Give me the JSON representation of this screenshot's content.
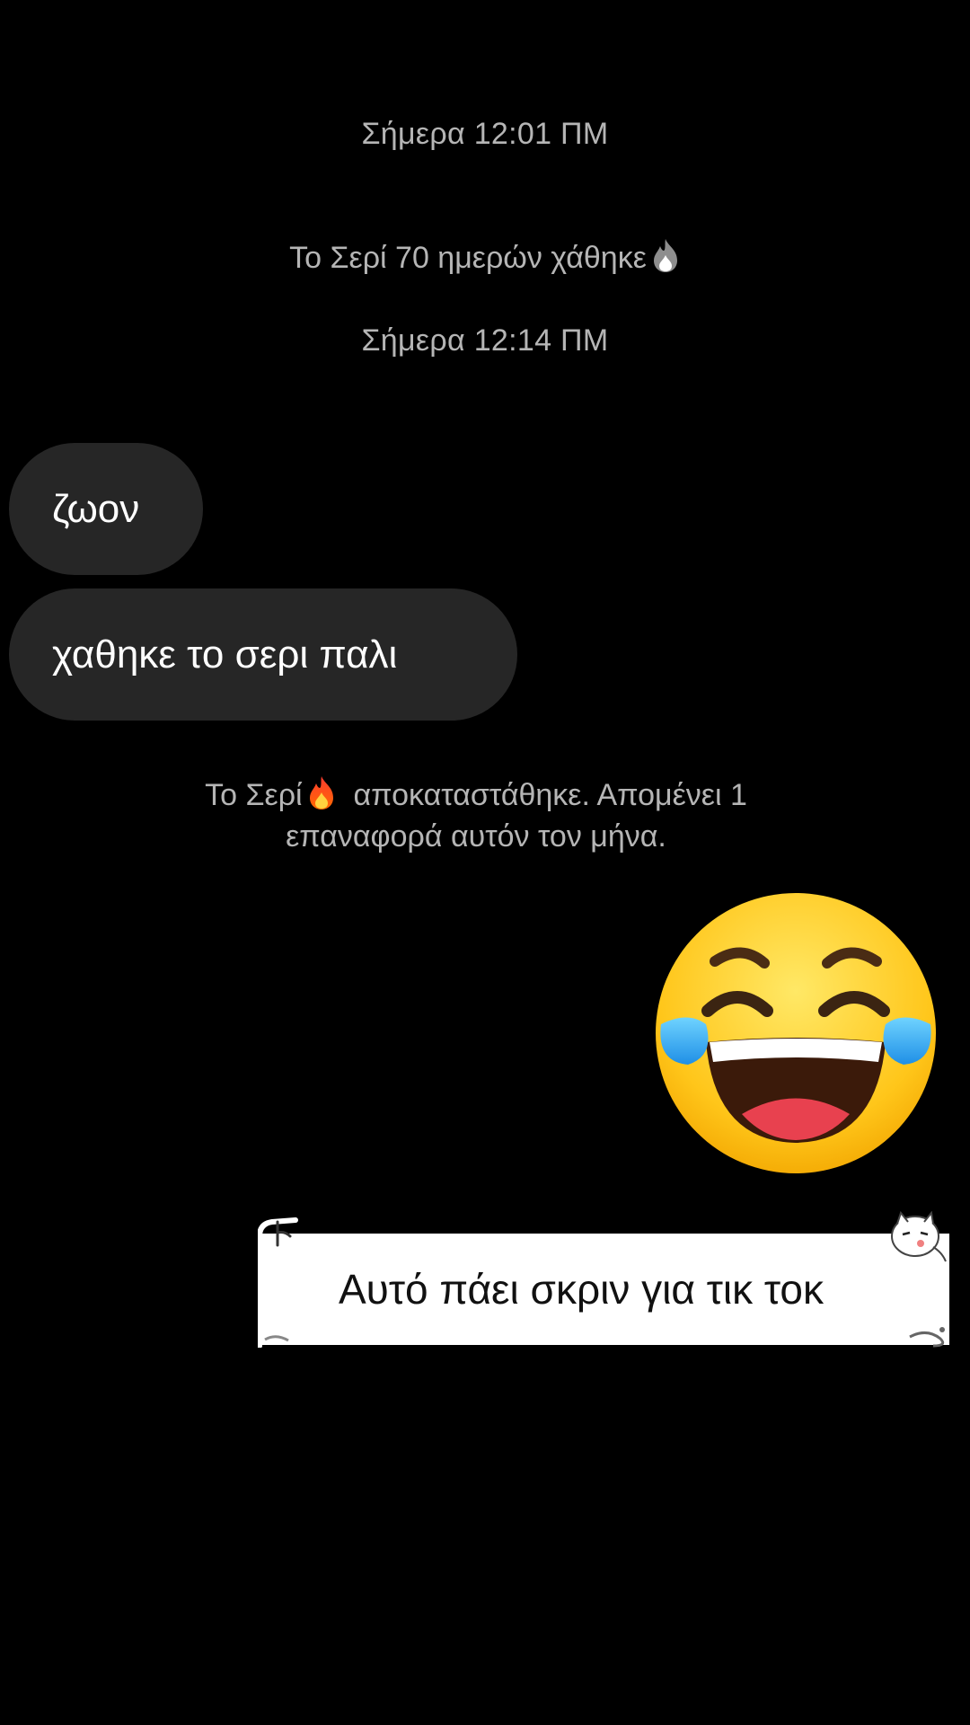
{
  "messages": {
    "timestamp_1": "Σήμερα 12:01 ΠΜ",
    "streak_lost": "Το Σερί 70 ημερών χάθηκε",
    "timestamp_2": "Σήμερα 12:14 ΠΜ",
    "bubble_1": "ζωον",
    "bubble_2": "χαθηκε το σερι παλι",
    "streak_restored_part1": "Το Σερί",
    "streak_restored_part2": "αποκαταστάθηκε. Απομένει 1",
    "streak_restored_line2": "επαναφορά αυτόν τον μήνα."
  },
  "icons": {
    "lost_streak_flame": "grey-flame-icon",
    "restored_streak_flame": "fire-icon",
    "reaction": "tears-of-joy-emoji"
  },
  "caption": {
    "text": "Αυτό πάει σκριν για τικ τοκ"
  },
  "colors": {
    "background": "#000000",
    "bubble": "#262626",
    "system_text": "#b5b5b5",
    "caption_bg": "#ffffff"
  }
}
